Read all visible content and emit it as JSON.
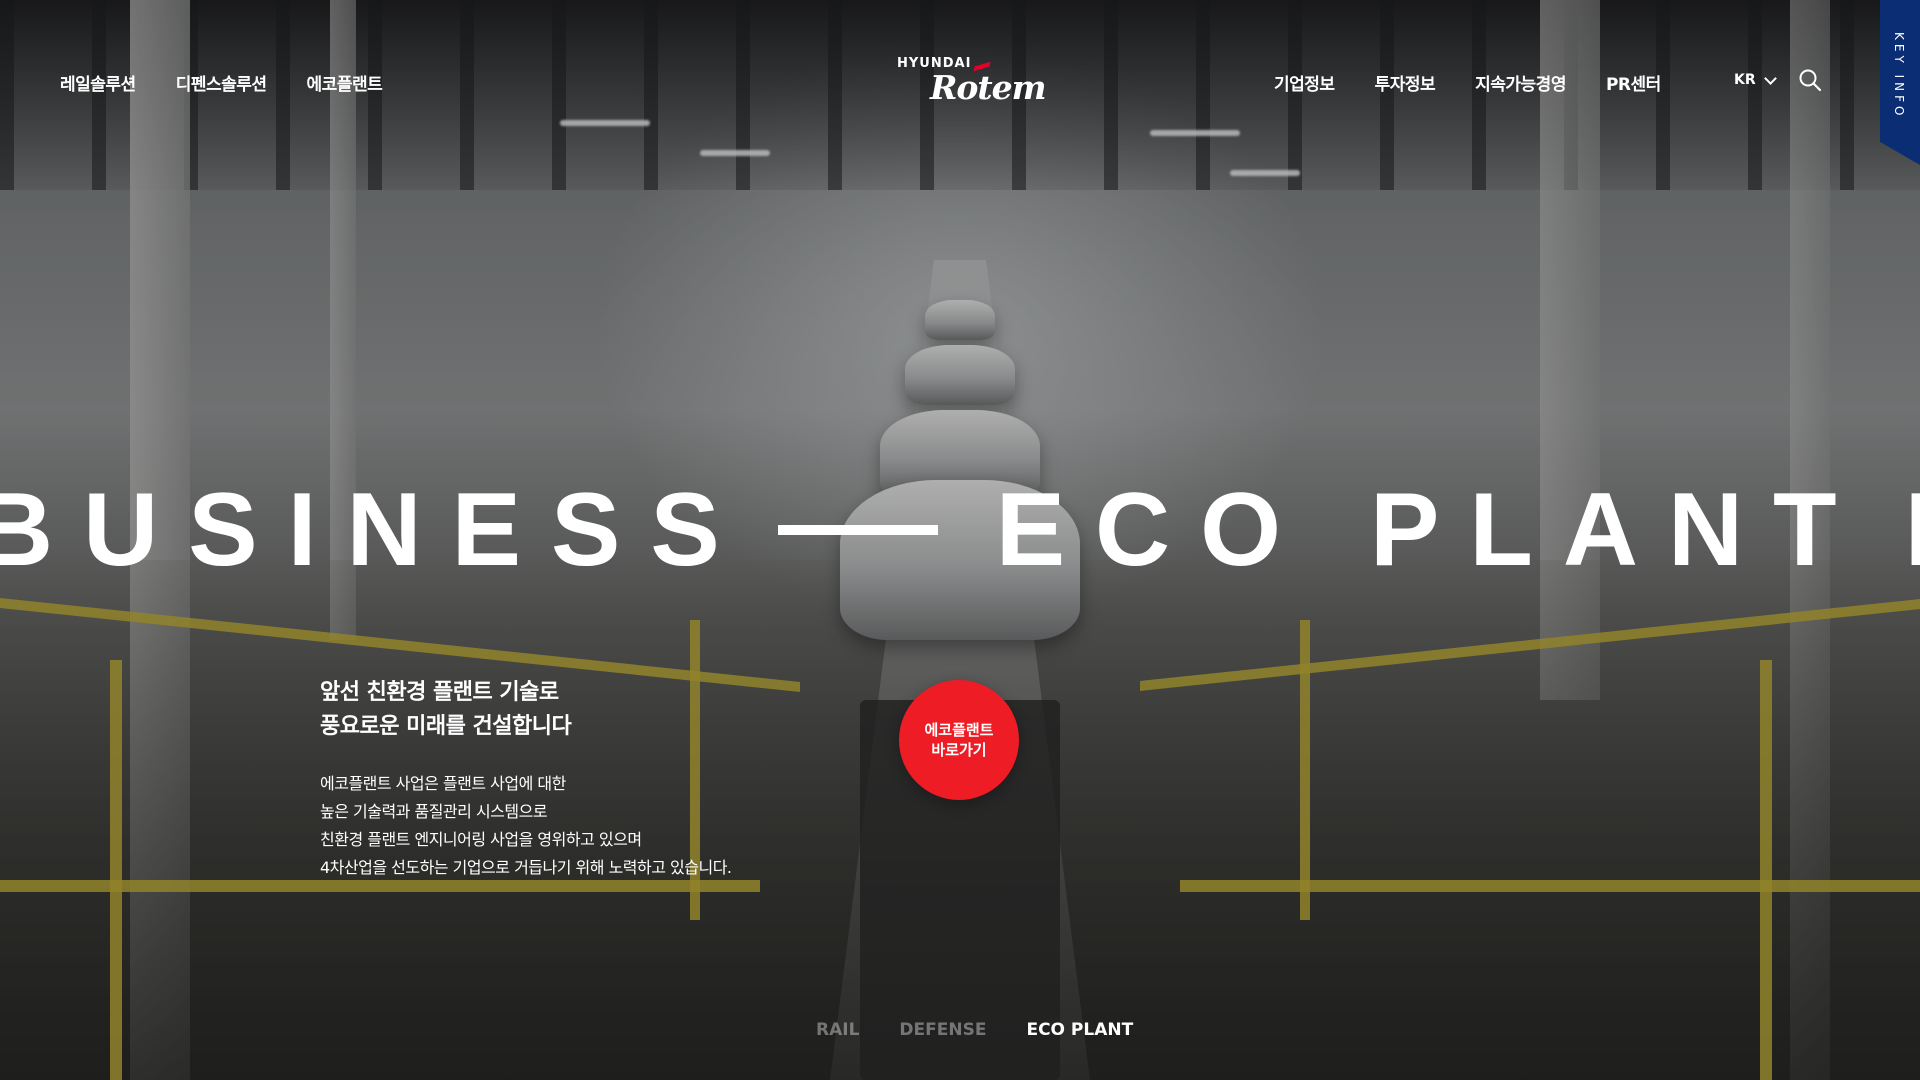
{
  "header": {
    "nav_left": [
      "레일솔루션",
      "디펜스솔루션",
      "에코플랜트"
    ],
    "nav_right": [
      "기업정보",
      "투자정보",
      "지속가능경영",
      "PR센터"
    ],
    "logo_top": "HYUNDAI",
    "logo_main": "Rotem",
    "language": "KR",
    "side_tab": "KEY INFO"
  },
  "hero": {
    "word_left": "BUSINESS",
    "word_right": "ECO PLANT",
    "word_tail": "E",
    "headline": [
      "앞선 친환경 플랜트 기술로",
      "풍요로운 미래를 건설합니다"
    ],
    "description": [
      "에코플랜트 사업은 플랜트 사업에 대한",
      "높은 기술력과 품질관리 시스템으로",
      "친환경 플랜트 엔지니어링 사업을 영위하고 있으며",
      "4차산업을 선도하는 기업으로 거듭나기 위해 노력하고 있습니다."
    ],
    "cta": [
      "에코플랜트",
      "바로가기"
    ]
  },
  "tabs": [
    {
      "label": "RAIL",
      "active": false
    },
    {
      "label": "DEFENSE",
      "active": false
    },
    {
      "label": "ECO PLANT",
      "active": true
    }
  ],
  "colors": {
    "cta": "#ee1c24",
    "key_info": "#0b2d73",
    "logo_accent": "#e4002b"
  },
  "icons": [
    "search-icon",
    "chevron-down-icon"
  ]
}
